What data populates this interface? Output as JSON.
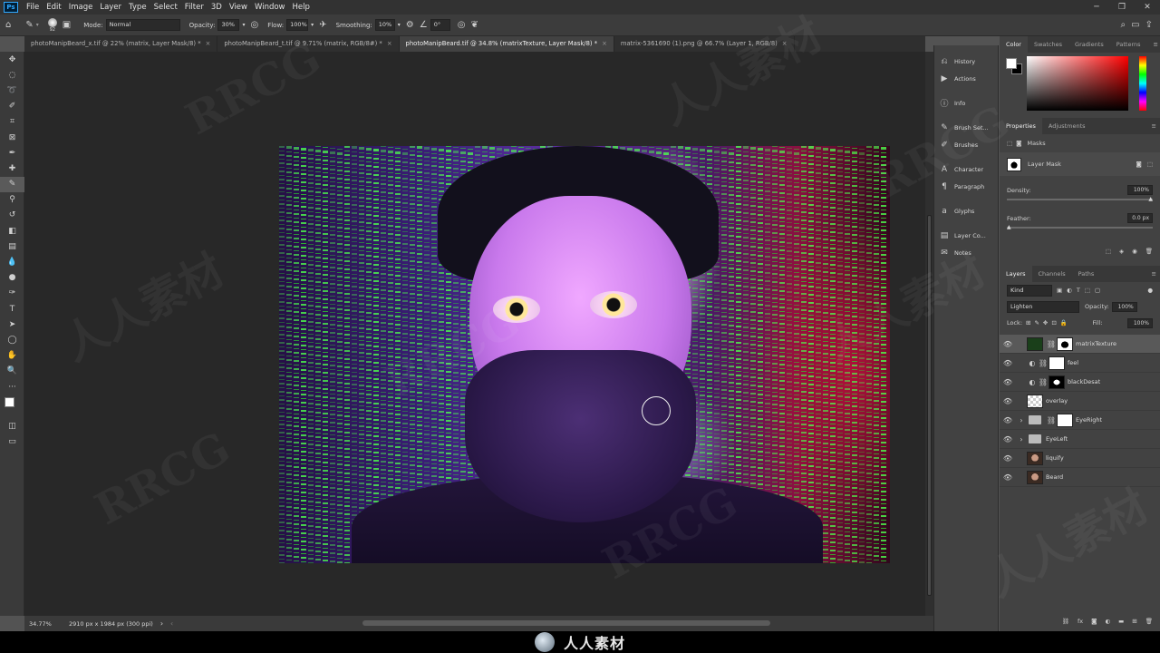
{
  "menu": [
    "File",
    "Edit",
    "Image",
    "Layer",
    "Type",
    "Select",
    "Filter",
    "3D",
    "View",
    "Window",
    "Help"
  ],
  "app_icon": "Ps",
  "options": {
    "brush_size": "92",
    "mode_label": "Mode:",
    "mode_value": "Normal",
    "opacity_label": "Opacity:",
    "opacity_value": "30%",
    "flow_label": "Flow:",
    "flow_value": "100%",
    "smoothing_label": "Smoothing:",
    "smoothing_value": "10%",
    "angle_value": "0°"
  },
  "tabs": [
    {
      "label": "photoManipBeard_x.tif @ 22% (matrix, Layer Mask/8) *",
      "active": false
    },
    {
      "label": "photoManipBeard_t.tif @ 9.71% (matrix, RGB/8#) *",
      "active": false
    },
    {
      "label": "photoManipBeard.tif @ 34.8% (matrixTexture, Layer Mask/8) *",
      "active": true
    },
    {
      "label": "matrix-5361690 (1).png @ 66.7% (Layer 1, RGB/8)",
      "active": false
    }
  ],
  "status": {
    "zoom": "34.77%",
    "doc_info": "2910 px x 1984 px (300 ppi)"
  },
  "icon_panel": [
    "History",
    "Actions",
    "Info",
    "Brush Set...",
    "Brushes",
    "Character",
    "Paragraph",
    "Glyphs",
    "Layer Co...",
    "Notes"
  ],
  "color_tabs": [
    "Color",
    "Swatches",
    "Gradients",
    "Patterns"
  ],
  "properties": {
    "tabs": [
      "Properties",
      "Adjustments"
    ],
    "masks_label": "Masks",
    "layer_mask_label": "Layer Mask",
    "density_label": "Density:",
    "density_value": "100%",
    "feather_label": "Feather:",
    "feather_value": "0.0 px"
  },
  "layers_panel": {
    "tabs": [
      "Layers",
      "Channels",
      "Paths"
    ],
    "kind_label": "Kind",
    "blend_mode": "Lighten",
    "opacity_label": "Opacity:",
    "opacity_value": "100%",
    "lock_label": "Lock:",
    "fill_label": "Fill:",
    "fill_value": "100%",
    "layers": [
      {
        "name": "matrixTexture",
        "selected": true
      },
      {
        "name": "feel",
        "selected": false
      },
      {
        "name": "blackDesat",
        "selected": false
      },
      {
        "name": "overlay",
        "selected": false
      },
      {
        "name": "EyeRight",
        "selected": false
      },
      {
        "name": "EyeLeft",
        "selected": false
      },
      {
        "name": "liquify",
        "selected": false
      },
      {
        "name": "Beard",
        "selected": false
      }
    ]
  },
  "watermark": {
    "brand": "人人素材",
    "text": "RRCG"
  }
}
